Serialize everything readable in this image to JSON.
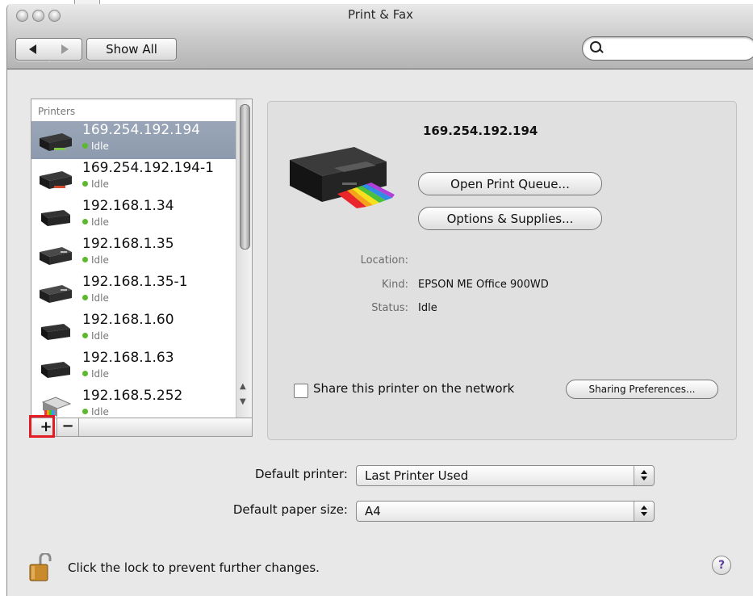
{
  "window": {
    "title": "Print & Fax"
  },
  "toolbar": {
    "show_all_label": "Show All",
    "search": {
      "placeholder": "",
      "value": ""
    }
  },
  "printers": {
    "header": "Printers",
    "items": [
      {
        "name": "169.254.192.194",
        "status": "Idle",
        "selected": true
      },
      {
        "name": "169.254.192.194-1",
        "status": "Idle"
      },
      {
        "name": "192.168.1.34",
        "status": "Idle"
      },
      {
        "name": "192.168.1.35",
        "status": "Idle"
      },
      {
        "name": "192.168.1.35-1",
        "status": "Idle"
      },
      {
        "name": "192.168.1.60",
        "status": "Idle"
      },
      {
        "name": "192.168.1.63",
        "status": "Idle"
      },
      {
        "name": "192.168.5.252",
        "status": "Idle"
      }
    ],
    "add_label": "+",
    "remove_label": "−"
  },
  "detail": {
    "name": "169.254.192.194",
    "open_queue_label": "Open Print Queue...",
    "options_supplies_label": "Options & Supplies...",
    "location_label": "Location:",
    "location_value": "",
    "kind_label": "Kind:",
    "kind_value": "EPSON ME Office 900WD",
    "status_label": "Status:",
    "status_value": "Idle",
    "share_label": "Share this printer on the network",
    "share_checked": false,
    "sharing_prefs_label": "Sharing Preferences..."
  },
  "defaults": {
    "default_printer_label": "Default printer:",
    "default_printer_value": "Last Printer Used",
    "default_paper_label": "Default paper size:",
    "default_paper_value": "A4"
  },
  "footer": {
    "lock_text": "Click the lock to prevent further changes.",
    "help_label": "?"
  },
  "colors": {
    "selection": "#8d9aad",
    "status_idle": "#5cb82c",
    "highlight": "#e31b23"
  }
}
